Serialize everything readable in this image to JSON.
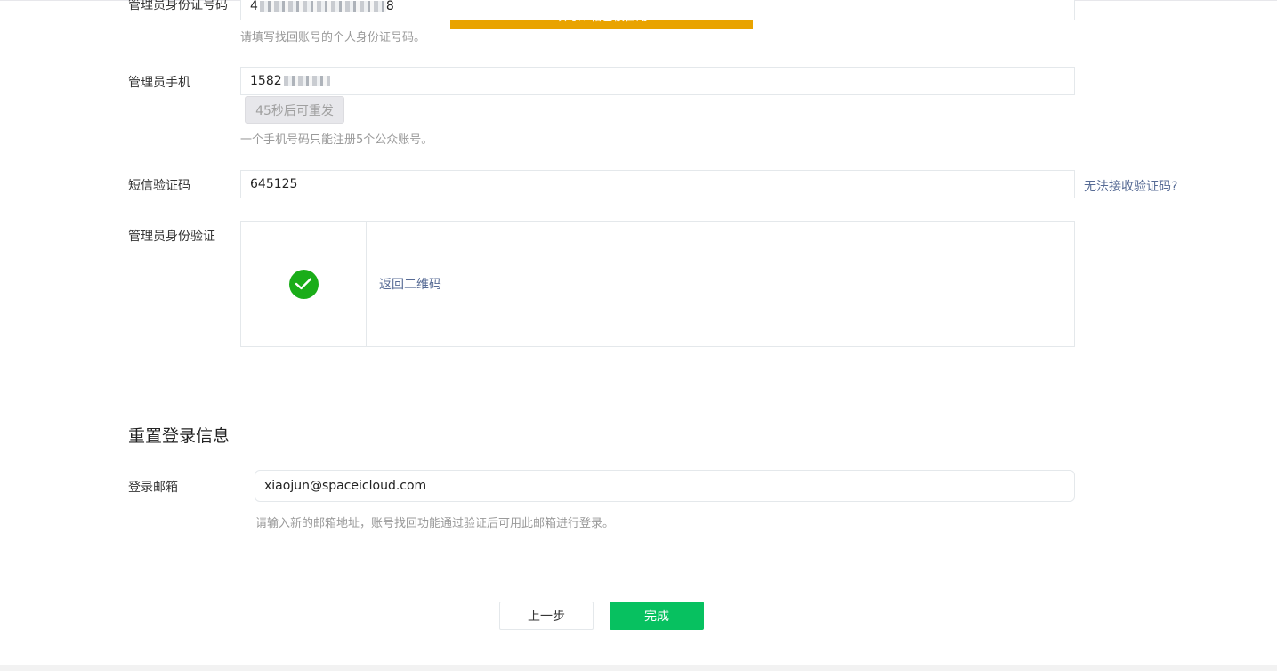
{
  "toast": {
    "message": "填写邮箱已被占用"
  },
  "id_number": {
    "label": "管理员身份证号码",
    "value_prefix": "4",
    "value_suffix": "8",
    "hint": "请填写找回账号的个人身份证号码。"
  },
  "phone": {
    "label": "管理员手机",
    "value_prefix": "1582",
    "resend_label": "45秒后可重发",
    "hint": "一个手机号码只能注册5个公众账号。"
  },
  "sms_code": {
    "label": "短信验证码",
    "value": "645125",
    "help_link": "无法接收验证码?"
  },
  "identity_verify": {
    "label": "管理员身份验证",
    "back_link": "返回二维码",
    "status_color": "#1aad19"
  },
  "reset_section": {
    "title": "重置登录信息",
    "email_label": "登录邮箱",
    "email_value": "xiaojun@spaceicloud.com",
    "email_hint": "请输入新的邮箱地址，账号找回功能通过验证后可用此邮箱进行登录。"
  },
  "actions": {
    "prev_label": "上一步",
    "done_label": "完成",
    "done_color": "#07c160"
  }
}
